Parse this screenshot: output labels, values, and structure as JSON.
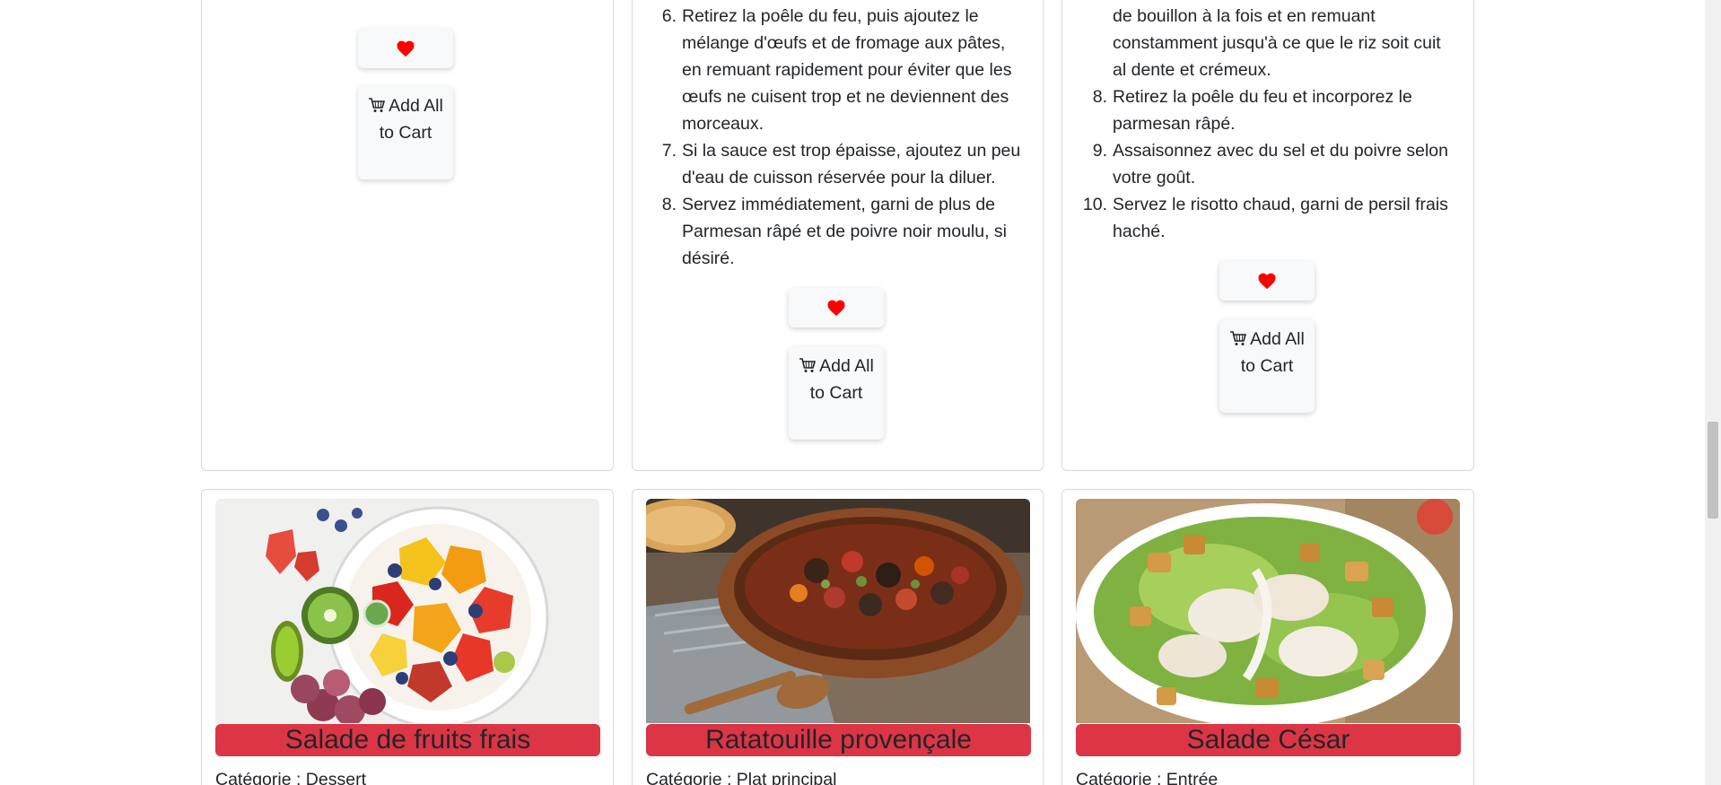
{
  "cards_top": [
    {
      "steps": [],
      "favorite_icon": "heart-icon",
      "cart_button_label": "Add All to Cart",
      "cart_icon": "cart-icon"
    },
    {
      "steps": [
        {
          "num": "6.",
          "text": "Retirez la poêle du feu, puis ajoutez le mélange d'œufs et de fromage aux pâtes, en remuant rapidement pour éviter que les œufs ne cuisent trop et ne deviennent des morceaux."
        },
        {
          "num": "7.",
          "text": "Si la sauce est trop épaisse, ajoutez un peu d'eau de cuisson réservée pour la diluer."
        },
        {
          "num": "8.",
          "text": "Servez immédiatement, garni de plus de Parmesan râpé et de poivre noir moulu, si désiré."
        }
      ],
      "favorite_icon": "heart-icon",
      "cart_button_label": "Add All to Cart",
      "cart_icon": "cart-icon"
    },
    {
      "steps": [
        {
          "num": "",
          "text": "de bouillon à la fois et en remuant constamment jusqu'à ce que le riz soit cuit al dente et crémeux."
        },
        {
          "num": "8.",
          "text": "Retirez la poêle du feu et incorporez le parmesan râpé."
        },
        {
          "num": "9.",
          "text": "Assaisonnez avec du sel et du poivre selon votre goût."
        },
        {
          "num": "10.",
          "text": "Servez le risotto chaud, garni de persil frais haché."
        }
      ],
      "favorite_icon": "heart-icon",
      "cart_button_label": "Add All to Cart",
      "cart_icon": "cart-icon"
    }
  ],
  "cards_bottom": [
    {
      "title": "Salade de fruits frais",
      "category": "Catégorie : Dessert"
    },
    {
      "title": "Ratatouille provençale",
      "category": "Catégorie : Plat principal"
    },
    {
      "title": "Salade César",
      "category": "Catégorie : Entrée"
    }
  ],
  "colors": {
    "title_bar": "#dc3545",
    "heart": "#ff0000"
  }
}
